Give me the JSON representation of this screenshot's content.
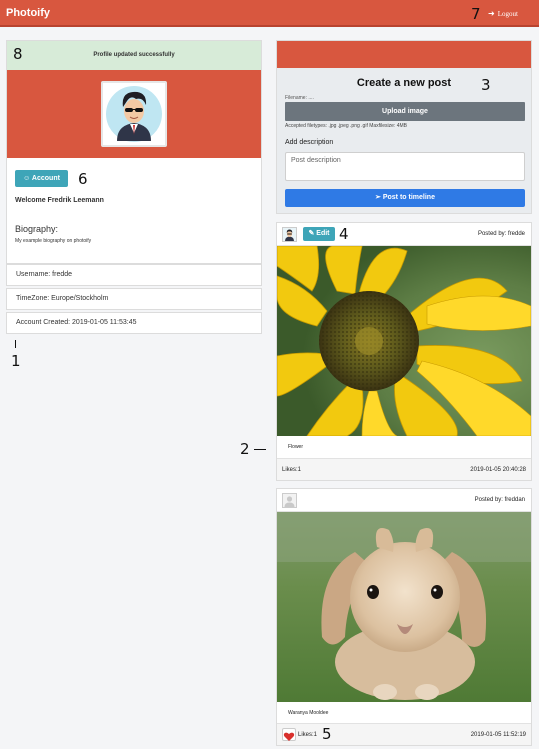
{
  "app": {
    "brand": "Photoify",
    "logout_label": "Logout"
  },
  "markers": [
    "1",
    "2",
    "3",
    "4",
    "5",
    "6",
    "7",
    "8"
  ],
  "profile": {
    "alert": "Profile updated successfully",
    "account_button": "Account",
    "welcome": "Welcome Fredrik Leemann",
    "bio_title": "Biography:",
    "bio_text": "My example biography on photoify",
    "username": "Username: fredde",
    "timezone": "TimeZone: Europe/Stockholm",
    "created": "Account Created: 2019-01-05 11:53:45"
  },
  "create_post": {
    "title": "Create a new post",
    "filename": "Filename: ....",
    "upload_button": "Upload image",
    "filetypes": "Accepted filetypes: .jpg .jpeg .png .gif Maxfilesize: 4MB",
    "add_description": "Add description",
    "description_placeholder": "Post description",
    "post_button": "Post to timeline"
  },
  "posts": [
    {
      "posted_by": "Posted by: fredde",
      "edit_label": "Edit",
      "caption": "Flower",
      "likes": "Likes:1",
      "date": "2019-01-05 20:40:28"
    },
    {
      "posted_by": "Posted by: freddan",
      "caption": "Waranya Mooldee",
      "likes": "Likes:1",
      "date": "2019-01-05 11:52:19"
    }
  ],
  "colors": {
    "brand_red": "#d8573f",
    "teal": "#3ea5b8",
    "blue": "#2f7ae5",
    "success_bg": "#d7ebd8"
  }
}
